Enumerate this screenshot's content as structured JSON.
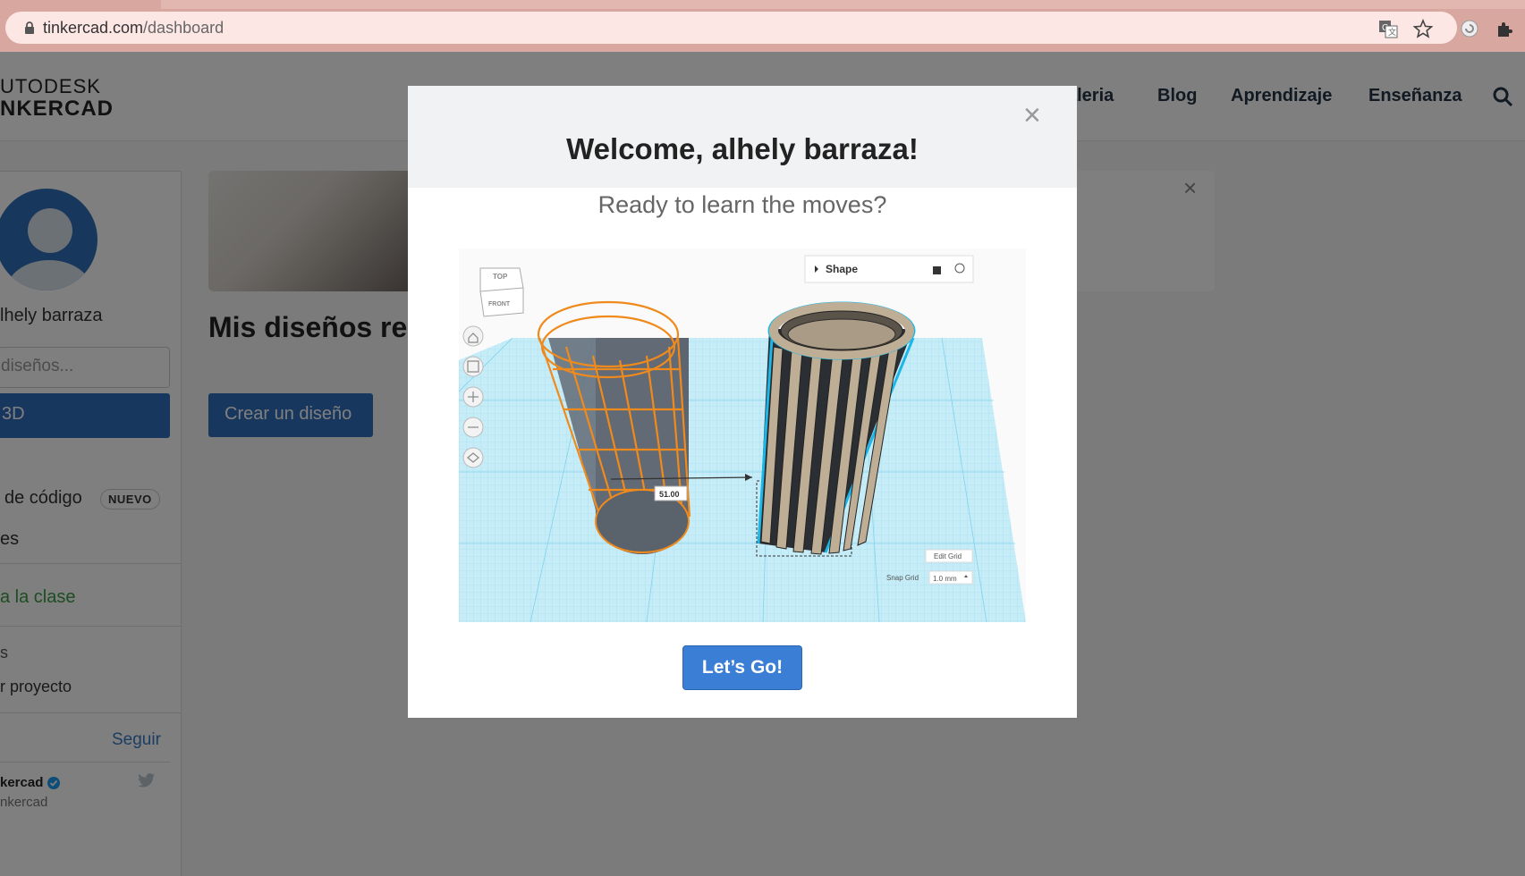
{
  "browser": {
    "url_host": "tinkercad.com",
    "url_path": "/dashboard"
  },
  "header": {
    "logo_line1": "UTODESK",
    "logo_line2": "NKERCAD",
    "nav": [
      "aleria",
      "Blog",
      "Aprendizaje",
      "Enseñanza"
    ]
  },
  "sidebar": {
    "user_name": "lhely barraza",
    "search_placeholder": "diseños...",
    "item_3d": "3D",
    "item_code": "de código",
    "badge_new": "NUEVO",
    "item_es": "es",
    "item_class": "a la clase",
    "item_s": "s",
    "item_project": "r proyecto",
    "follow": "Seguir",
    "twitter_name": "kercad",
    "twitter_handle": "nkercad"
  },
  "main": {
    "section_title": "Mis diseños re",
    "create_button": "Crear un diseño"
  },
  "modal": {
    "title": "Welcome, alhely barraza!",
    "subtitle": "Ready to learn the moves?",
    "cta": "Let’s Go!",
    "close": "×",
    "preview": {
      "viewcube_top": "TOP",
      "viewcube_front": "FRONT",
      "panel_label": "Shape",
      "dimension": "51.00",
      "edit_grid": "Edit Grid",
      "snap_grid_label": "Snap Grid",
      "snap_grid_value": "1.0 mm"
    }
  },
  "colors": {
    "primary_blue": "#2f6fbf",
    "modal_button": "#3a7fd5",
    "wireframe_orange": "#f08a1c",
    "grid_cyan": "#7fd3ec"
  }
}
